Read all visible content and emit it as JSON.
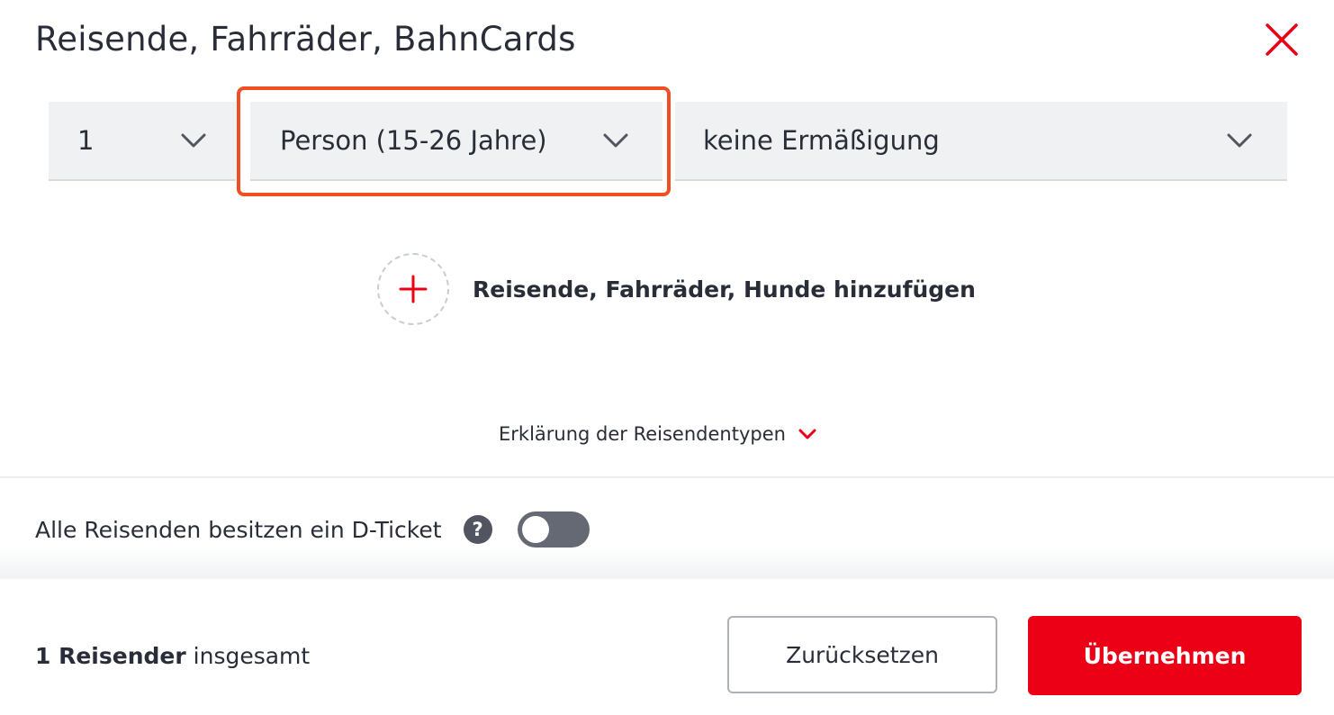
{
  "dialog": {
    "title": "Reisende, Fahrräder, BahnCards",
    "close_icon": "close-icon"
  },
  "traveler": {
    "count": "1",
    "type": "Person (15-26 Jahre)",
    "discount": "keine Ermäßigung"
  },
  "add": {
    "label": "Reisende, Fahrräder, Hunde hinzufügen",
    "icon": "plus-icon"
  },
  "explanation": {
    "label": "Erklärung der Reisendentypen",
    "icon": "chevron-down-icon"
  },
  "dticket": {
    "label": "Alle Reisenden besitzen ein D-Ticket",
    "help_glyph": "?",
    "toggle_on": false
  },
  "footer": {
    "total_count": "1 Reisender",
    "total_suffix": " insgesamt",
    "reset_label": "Zurücksetzen",
    "apply_label": "Übernehmen"
  },
  "colors": {
    "accent_red": "#ec0016",
    "highlight": "#f04e23",
    "text": "#282d37",
    "select_bg": "#f0f1f3"
  }
}
